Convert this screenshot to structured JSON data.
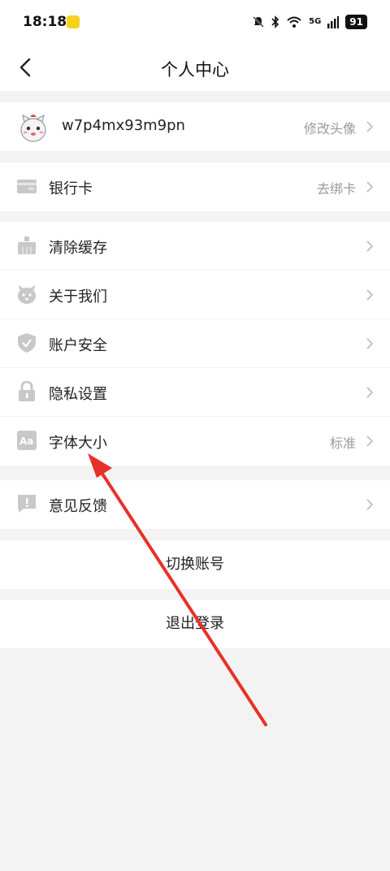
{
  "status_bar": {
    "time": "18:18",
    "network": "5G",
    "battery": "91"
  },
  "navbar": {
    "title": "个人中心",
    "back_icon": "chevron-left-icon"
  },
  "profile": {
    "username": "w7p4mx93m9pn",
    "action": "修改头像"
  },
  "bank": {
    "label": "银行卡",
    "value": "去绑卡"
  },
  "settings": [
    {
      "label": "清除缓存",
      "value": "",
      "icon": "broom-icon"
    },
    {
      "label": "关于我们",
      "value": "",
      "icon": "mascot-icon"
    },
    {
      "label": "账户安全",
      "value": "",
      "icon": "shield-icon"
    },
    {
      "label": "隐私设置",
      "value": "",
      "icon": "lock-icon"
    },
    {
      "label": "字体大小",
      "value": "标准",
      "icon": "font-size-icon"
    }
  ],
  "feedback": {
    "label": "意见反馈"
  },
  "actions": {
    "switch_account": "切换账号",
    "logout": "退出登录"
  },
  "colors": {
    "arrow": "#e8302a",
    "icon_gray": "#c8c8c8",
    "page_bg": "#f3f3f3"
  }
}
